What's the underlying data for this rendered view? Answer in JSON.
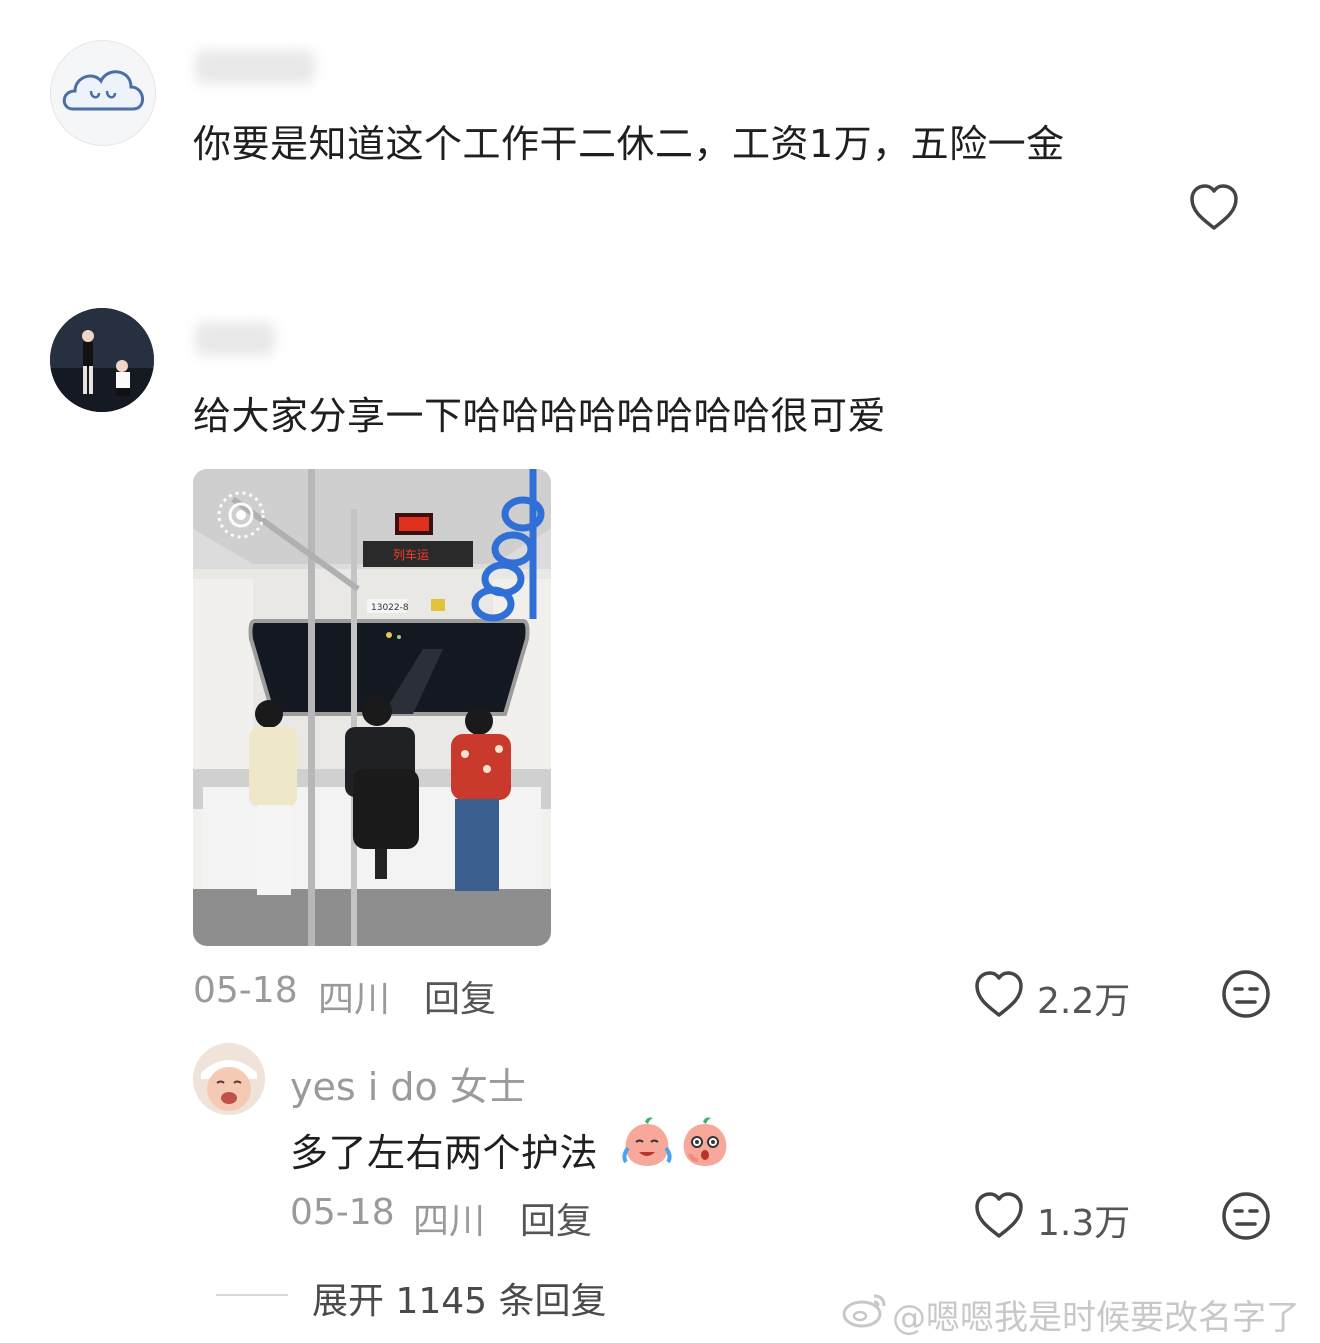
{
  "comment1": {
    "text": "你要是知道这个工作干二休二，工资1万，五险一金"
  },
  "comment2": {
    "text": "给大家分享一下哈哈哈哈哈哈哈哈很可爱",
    "photo": {
      "display_top": "列车运",
      "display_code": "13022-8"
    },
    "date": "05-18",
    "location": "四川",
    "reply_label": "回复",
    "like_count": "2.2万"
  },
  "reply1": {
    "username": "yes i do 女士",
    "text": "多了左右两个护法",
    "date": "05-18",
    "location": "四川",
    "reply_label": "回复",
    "like_count": "1.3万"
  },
  "expand": {
    "label": "展开 1145 条回复"
  },
  "watermark": {
    "text": "@嗯嗯我是时候要改名字了"
  },
  "icons": {
    "heart": "heart-icon",
    "dislike": "dislike-face-icon",
    "weibo": "weibo-logo-icon"
  }
}
